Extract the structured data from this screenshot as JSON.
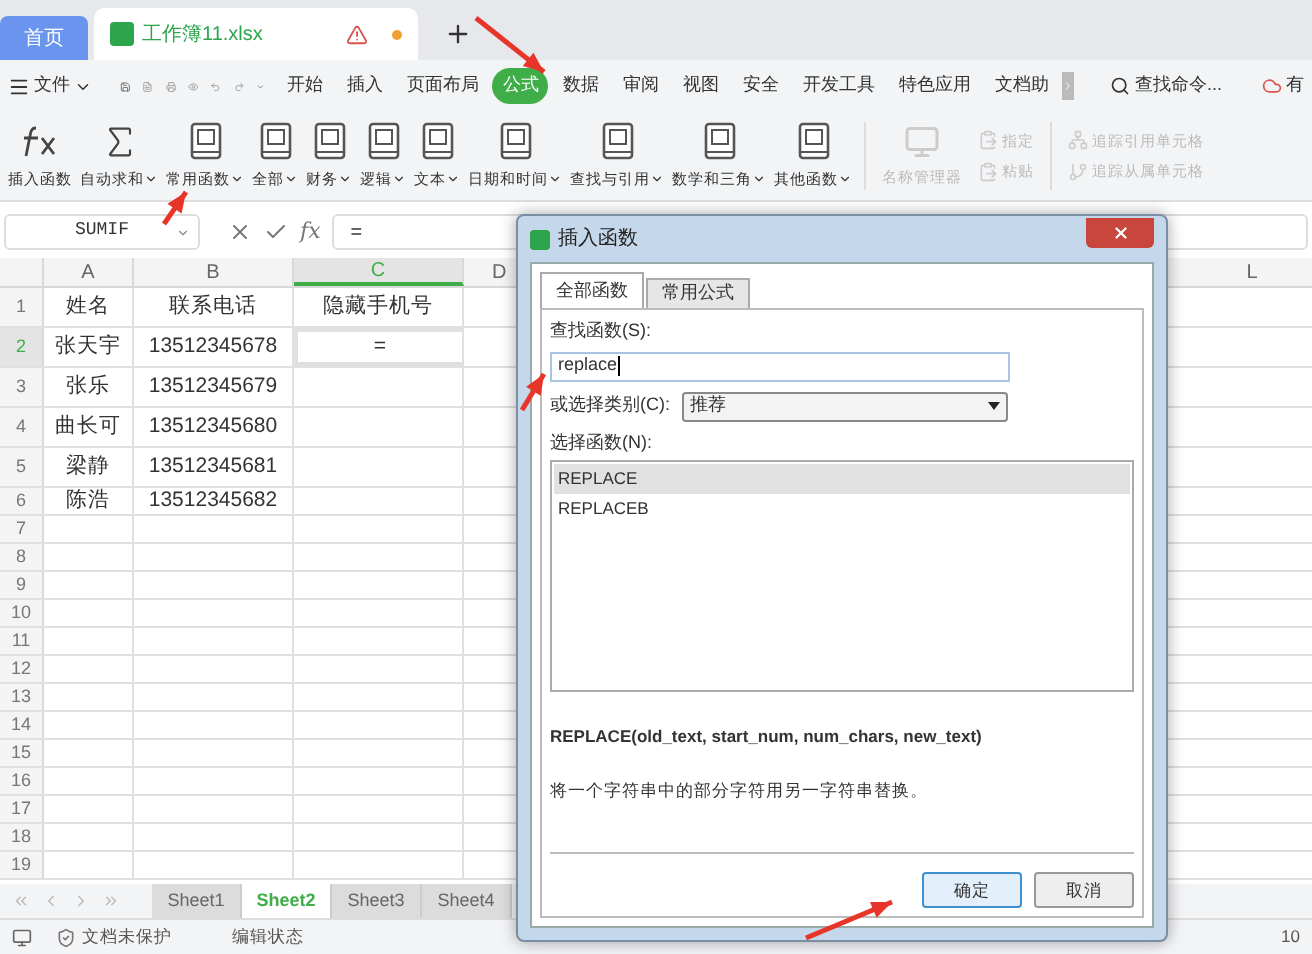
{
  "tabs": [
    {
      "label": "首页",
      "kind": "home",
      "selected": false
    },
    {
      "label": "工作簿11.xlsx",
      "kind": "file",
      "selected": true
    }
  ],
  "menu": {
    "file": "文件",
    "items": [
      {
        "label": "开始",
        "selected": false
      },
      {
        "label": "插入",
        "selected": false
      },
      {
        "label": "页面布局",
        "selected": false
      },
      {
        "label": "公式",
        "selected": true
      },
      {
        "label": "数据",
        "selected": false
      },
      {
        "label": "审阅",
        "selected": false
      },
      {
        "label": "视图",
        "selected": false
      },
      {
        "label": "安全",
        "selected": false
      },
      {
        "label": "开发工具",
        "selected": false
      },
      {
        "label": "特色应用",
        "selected": false
      },
      {
        "label": "文档助",
        "selected": false
      }
    ],
    "search": "查找命令...",
    "account": "有"
  },
  "ribbon": [
    {
      "label": "插入函数",
      "kind": "fx",
      "dropdown": false
    },
    {
      "label": "自动求和",
      "kind": "sum",
      "dropdown": true
    },
    {
      "label": "常用函数",
      "kind": "book",
      "dropdown": true
    },
    {
      "label": "全部",
      "kind": "book",
      "dropdown": true
    },
    {
      "label": "财务",
      "kind": "book",
      "dropdown": true
    },
    {
      "label": "逻辑",
      "kind": "book",
      "dropdown": true
    },
    {
      "label": "文本",
      "kind": "book",
      "dropdown": true
    },
    {
      "label": "日期和时间",
      "kind": "book",
      "dropdown": true
    },
    {
      "label": "查找与引用",
      "kind": "book",
      "dropdown": true
    },
    {
      "label": "数学和三角",
      "kind": "book",
      "dropdown": true
    },
    {
      "label": "其他函数",
      "kind": "book",
      "dropdown": true
    }
  ],
  "ribbon_disabled": {
    "big": "名称管理器",
    "small": [
      "指定",
      "粘贴"
    ],
    "trace": [
      "追踪引用单元格",
      "追踪从属单元格"
    ]
  },
  "formula_bar": {
    "name_box": "SUMIF",
    "fx": "fx",
    "value": "="
  },
  "sheet": {
    "columns": [
      {
        "label": "A",
        "selected": false
      },
      {
        "label": "B",
        "selected": false
      },
      {
        "label": "C",
        "selected": true
      },
      {
        "label": "D",
        "selected": false
      }
    ],
    "right_column": "L",
    "rows": [
      {
        "num": "1",
        "selected": false,
        "cells": [
          "姓名",
          "联系电话",
          "隐藏手机号",
          ""
        ]
      },
      {
        "num": "2",
        "selected": true,
        "cells": [
          "张天宇",
          "13512345678",
          "=",
          ""
        ]
      },
      {
        "num": "3",
        "selected": false,
        "cells": [
          "张乐",
          "13512345679",
          "",
          ""
        ]
      },
      {
        "num": "4",
        "selected": false,
        "cells": [
          "曲长可",
          "13512345680",
          "",
          ""
        ]
      },
      {
        "num": "5",
        "selected": false,
        "cells": [
          "梁静",
          "13512345681",
          "",
          ""
        ]
      },
      {
        "num": "6",
        "selected": false,
        "cells": [
          "陈浩",
          "13512345682",
          "",
          ""
        ]
      },
      {
        "num": "7",
        "selected": false,
        "cells": [
          "",
          "",
          "",
          ""
        ]
      },
      {
        "num": "8",
        "selected": false,
        "cells": [
          "",
          "",
          "",
          ""
        ]
      },
      {
        "num": "9",
        "selected": false,
        "cells": [
          "",
          "",
          "",
          ""
        ]
      },
      {
        "num": "10",
        "selected": false,
        "cells": [
          "",
          "",
          "",
          ""
        ]
      },
      {
        "num": "11",
        "selected": false,
        "cells": [
          "",
          "",
          "",
          ""
        ]
      },
      {
        "num": "12",
        "selected": false,
        "cells": [
          "",
          "",
          "",
          ""
        ]
      },
      {
        "num": "13",
        "selected": false,
        "cells": [
          "",
          "",
          "",
          ""
        ]
      },
      {
        "num": "14",
        "selected": false,
        "cells": [
          "",
          "",
          "",
          ""
        ]
      },
      {
        "num": "15",
        "selected": false,
        "cells": [
          "",
          "",
          "",
          ""
        ]
      },
      {
        "num": "16",
        "selected": false,
        "cells": [
          "",
          "",
          "",
          ""
        ]
      },
      {
        "num": "17",
        "selected": false,
        "cells": [
          "",
          "",
          "",
          ""
        ]
      },
      {
        "num": "18",
        "selected": false,
        "cells": [
          "",
          "",
          "",
          ""
        ]
      },
      {
        "num": "19",
        "selected": false,
        "cells": [
          "",
          "",
          "",
          ""
        ]
      }
    ]
  },
  "sheet_tabs": [
    {
      "label": "Sheet1",
      "selected": false
    },
    {
      "label": "Sheet2",
      "selected": true
    },
    {
      "label": "Sheet3",
      "selected": false
    },
    {
      "label": "Sheet4",
      "selected": false
    }
  ],
  "status_bar": {
    "protection": "文档未保护",
    "mode": "编辑状态",
    "zoom": "10"
  },
  "dialog": {
    "title": "插入函数",
    "tabs": [
      {
        "label": "全部函数",
        "selected": true
      },
      {
        "label": "常用公式",
        "selected": false
      }
    ],
    "search_label": "查找函数(S):",
    "search_value": "replace",
    "category_label": "或选择类别(C):",
    "category": "推荐",
    "list_label": "选择函数(N):",
    "functions": [
      {
        "name": "REPLACE",
        "selected": true
      },
      {
        "name": "REPLACEB",
        "selected": false
      }
    ],
    "signature": "REPLACE(old_text, start_num, num_chars, new_text)",
    "description": "将一个字符串中的部分字符用另一字符串替换。",
    "buttons": [
      {
        "label": "确定",
        "kind": "primary"
      },
      {
        "label": "取消",
        "kind": "secondary"
      }
    ]
  }
}
